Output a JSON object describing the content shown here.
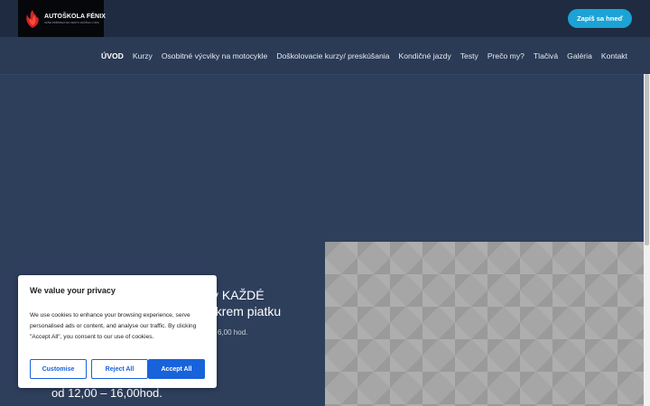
{
  "brand": {
    "name": "AUTOŠKOLA FÉNIX",
    "tagline": "VAŠE PRÍPRAVA NA CESTU ZAČÍNA U NÁS"
  },
  "header": {
    "cta_label": "Zapíš sa hneď"
  },
  "nav": {
    "items": [
      {
        "label": "ÚVOD",
        "active": true
      },
      {
        "label": "Kurzy"
      },
      {
        "label": "Osobitné výcviky na motocykle"
      },
      {
        "label": "Doškolovacie kurzy/ preskúšania"
      },
      {
        "label": "Kondičné jazdy"
      },
      {
        "label": "Testy"
      },
      {
        "label": "Prečo my?"
      },
      {
        "label": "Tlačivá"
      },
      {
        "label": "Galéria"
      },
      {
        "label": "Kontakt"
      }
    ]
  },
  "hero": {
    "line1_fragment": "v KAŽDÉ",
    "line2_fragment": "okrem piatku",
    "hours_fragment": "6,00 hod.",
    "bottom_line": "od 12,00 – 16,00hod."
  },
  "cookie": {
    "title": "We value your privacy",
    "text": "We use cookies to enhance your browsing experience, serve personalised ads or content, and analyse our traffic. By clicking \"Accept All\", you consent to our use of cookies.",
    "customise_label": "Customise",
    "reject_label": "Reject All",
    "accept_label": "Accept All"
  },
  "colors": {
    "accent": "#1ba3d5",
    "cookie_primary": "#1863dc",
    "background": "#2e3f5c",
    "topbar": "#1f2b40"
  }
}
